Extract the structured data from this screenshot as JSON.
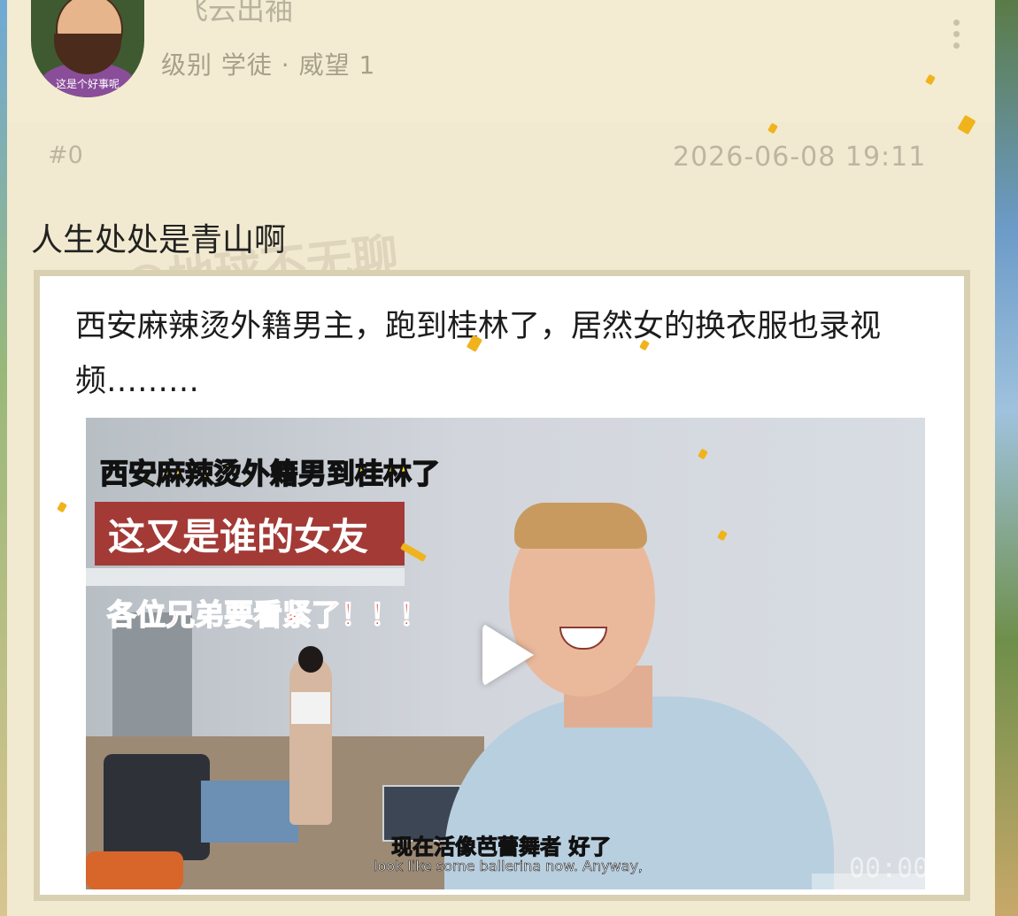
{
  "user": {
    "name": "飞云出袖",
    "meta": "级别 学徒 · 威望 1",
    "avatar_caption": "这是个好事呢"
  },
  "post": {
    "floor": "#0",
    "timestamp": "2026-06-08 19:11",
    "text": "人生处处是青山啊",
    "watermark": "@地球不无聊"
  },
  "quote": {
    "text": "西安麻辣烫外籍男主，跑到桂林了，居然女的换衣服也录视频………"
  },
  "video": {
    "caption_yellow": "西安麻辣烫外籍男到桂林了",
    "caption_box": "这又是谁的女友",
    "caption_red": "各位兄弟要看紧了！！！",
    "subtitle_cn": "现在活像芭蕾舞者 好了",
    "subtitle_en": "look like some ballerina now. Anyway,",
    "time": "00:00",
    "play_icon": "play-icon"
  },
  "colors": {
    "panel": "#f2ead0",
    "accent_red": "#a33a36",
    "caption_yellow": "#ffe11a"
  }
}
